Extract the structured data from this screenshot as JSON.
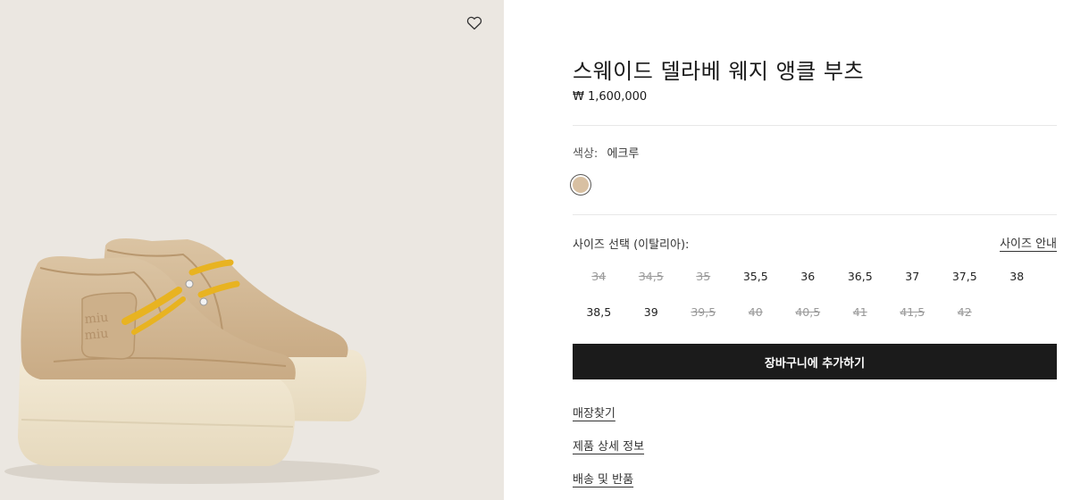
{
  "product": {
    "title": "스웨이드 델라베 웨지 앵클 부츠",
    "price": "₩ 1,600,000",
    "image_logo_text": "miu miu"
  },
  "color": {
    "label": "색상:",
    "value": "에크루",
    "swatch_hex": "#d8c0a2"
  },
  "size": {
    "label": "사이즈 선택 (이탈리아):",
    "guide_label": "사이즈 안내",
    "options": [
      {
        "value": "34",
        "available": false
      },
      {
        "value": "34,5",
        "available": false
      },
      {
        "value": "35",
        "available": false
      },
      {
        "value": "35,5",
        "available": true
      },
      {
        "value": "36",
        "available": true
      },
      {
        "value": "36,5",
        "available": true
      },
      {
        "value": "37",
        "available": true
      },
      {
        "value": "37,5",
        "available": true
      },
      {
        "value": "38",
        "available": true
      },
      {
        "value": "38,5",
        "available": true
      },
      {
        "value": "39",
        "available": true
      },
      {
        "value": "39,5",
        "available": false
      },
      {
        "value": "40",
        "available": false
      },
      {
        "value": "40,5",
        "available": false
      },
      {
        "value": "41",
        "available": false
      },
      {
        "value": "41,5",
        "available": false
      },
      {
        "value": "42",
        "available": false
      }
    ]
  },
  "actions": {
    "add_to_cart": "장바구니에 추가하기"
  },
  "links": {
    "store_finder": "매장찾기",
    "product_details": "제품 상세 정보",
    "shipping_returns": "배송 및 반품"
  },
  "icons": {
    "wishlist": "heart-icon"
  },
  "colors": {
    "image_background": "#ebe7e1",
    "button_background": "#1b1b1b",
    "lace": "#e8b321"
  }
}
